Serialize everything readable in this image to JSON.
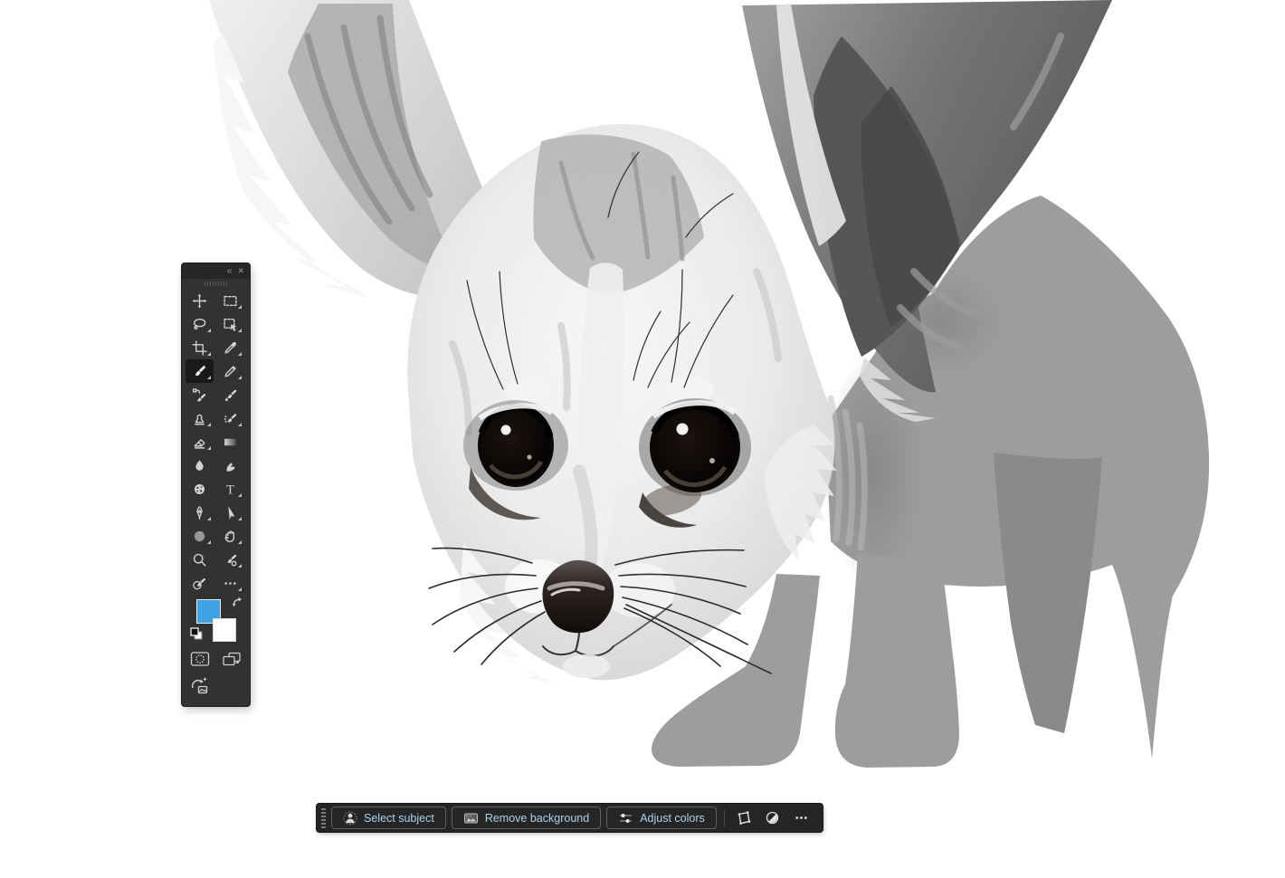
{
  "canvas": {
    "background": "#ffffff",
    "artwork_subject": "fennec-fox-grayscale-digital-painting",
    "body_blockin_gray": "#9d9d9d",
    "far_leg_gray": "#8a8a8a"
  },
  "colors": {
    "foreground_swatch": "#3fa3e3",
    "background_swatch": "#ffffff",
    "panel_bg": "#323232",
    "panel_header_bg": "#272727",
    "taskbar_bg": "#252526",
    "taskbar_text": "#a9d2ef",
    "icon_gray": "#d2d2d2"
  },
  "tools_panel": {
    "collapse_glyph": "«",
    "close_glyph": "✕",
    "type_tool_glyph": "T",
    "tools": [
      {
        "name": "move",
        "flyout": false,
        "selected": false
      },
      {
        "name": "marquee",
        "flyout": true,
        "selected": false
      },
      {
        "name": "lasso",
        "flyout": true,
        "selected": false
      },
      {
        "name": "object-selection",
        "flyout": true,
        "selected": false
      },
      {
        "name": "crop",
        "flyout": true,
        "selected": false
      },
      {
        "name": "eyedropper",
        "flyout": true,
        "selected": false
      },
      {
        "name": "brush",
        "flyout": true,
        "selected": true
      },
      {
        "name": "pencil",
        "flyout": true,
        "selected": false
      },
      {
        "name": "replace-color-brush",
        "flyout": false,
        "selected": false
      },
      {
        "name": "mixer-brush",
        "flyout": false,
        "selected": false
      },
      {
        "name": "clone-stamp",
        "flyout": true,
        "selected": false
      },
      {
        "name": "art-history-brush",
        "flyout": true,
        "selected": false
      },
      {
        "name": "eraser",
        "flyout": true,
        "selected": false
      },
      {
        "name": "gradient",
        "flyout": false,
        "selected": false
      },
      {
        "name": "blur",
        "flyout": false,
        "selected": false
      },
      {
        "name": "smudge",
        "flyout": false,
        "selected": false
      },
      {
        "name": "sponge",
        "flyout": false,
        "selected": false
      },
      {
        "name": "type",
        "flyout": true,
        "selected": false
      },
      {
        "name": "pen",
        "flyout": true,
        "selected": false
      },
      {
        "name": "path-select",
        "flyout": true,
        "selected": false
      },
      {
        "name": "ellipse-shape",
        "flyout": true,
        "selected": false
      },
      {
        "name": "hand",
        "flyout": true,
        "selected": false
      },
      {
        "name": "zoom",
        "flyout": false,
        "selected": false
      },
      {
        "name": "color-replacement",
        "flyout": true,
        "selected": false
      },
      {
        "name": "pattern-brush",
        "flyout": false,
        "selected": false
      },
      {
        "name": "more-tools",
        "flyout": true,
        "selected": false
      }
    ],
    "color_controls": [
      "foreground-color-swatch",
      "background-color-swatch",
      "swap-colors-icon",
      "default-colors-icon"
    ],
    "bottom_buttons": [
      "quick-mask-icon",
      "screen-mode-icon",
      "refresh-image-icon"
    ]
  },
  "taskbar": {
    "buttons": [
      {
        "icon": "person-icon",
        "label": "Select subject"
      },
      {
        "icon": "image-icon",
        "label": "Remove background"
      },
      {
        "icon": "sliders-icon",
        "label": "Adjust colors"
      }
    ],
    "icon_buttons": [
      "transform-warp-icon",
      "adjustment-half-circle-icon",
      "more-options-icon"
    ]
  }
}
